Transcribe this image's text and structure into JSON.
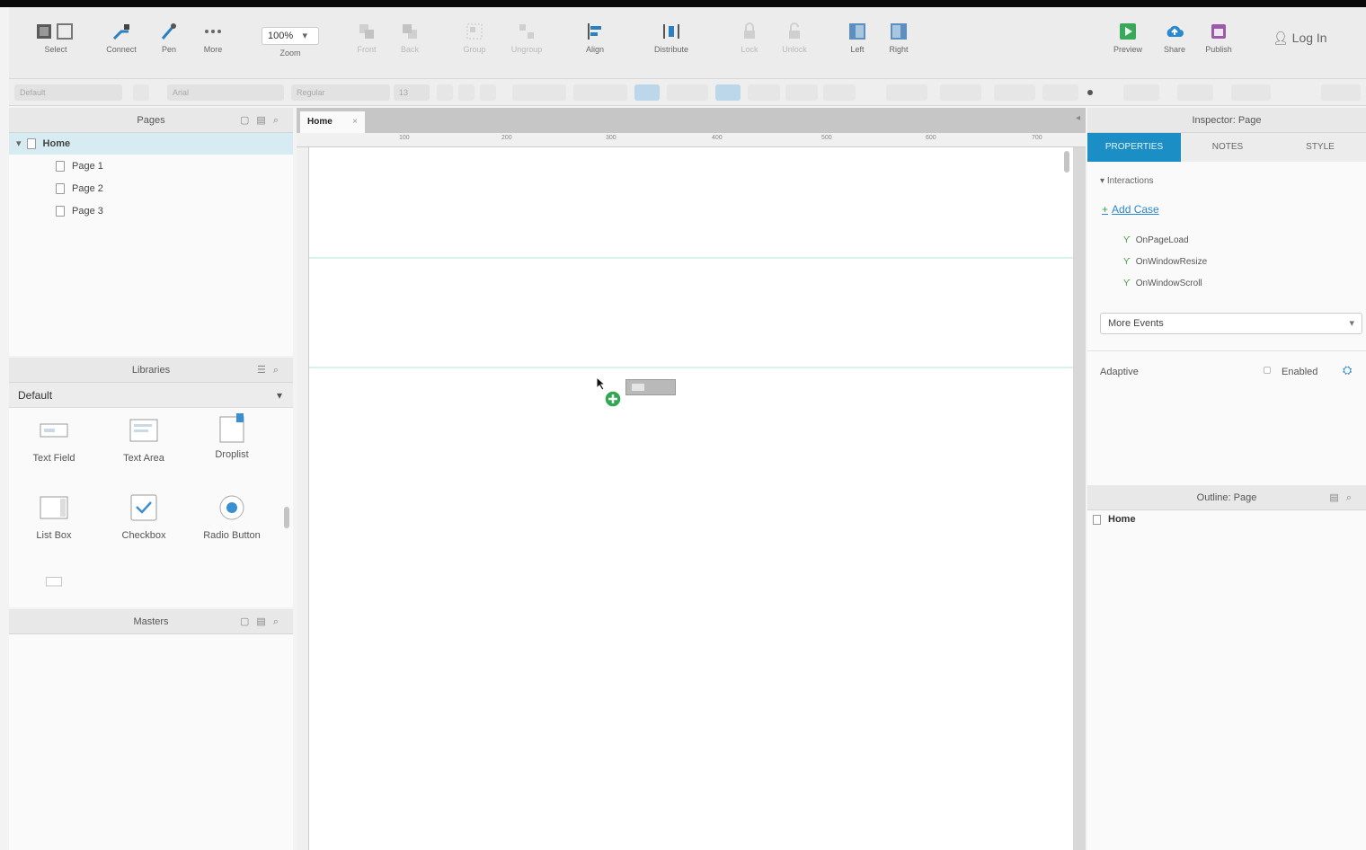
{
  "toolbar": {
    "select_label": "Select",
    "connect_label": "Connect",
    "pen_label": "Pen",
    "more_label": "More",
    "zoom_value": "100%",
    "zoom_label": "Zoom",
    "front_label": "Front",
    "back_label": "Back",
    "group_label": "Group",
    "ungroup_label": "Ungroup",
    "align_label": "Align",
    "distribute_label": "Distribute",
    "lock_label": "Lock",
    "unlock_label": "Unlock",
    "left_label": "Left",
    "right_label": "Right",
    "preview_label": "Preview",
    "share_label": "Share",
    "publish_label": "Publish",
    "login_label": "Log In"
  },
  "formatbar": {
    "style_value": "Default",
    "font_value": "Arial",
    "weight_value": "Regular",
    "size_value": "13"
  },
  "pages_panel": {
    "title": "Pages",
    "items": [
      {
        "label": "Home"
      },
      {
        "label": "Page 1"
      },
      {
        "label": "Page 2"
      },
      {
        "label": "Page 3"
      }
    ]
  },
  "libraries_panel": {
    "title": "Libraries",
    "selected_library": "Default",
    "widgets": [
      {
        "label": "Text Field"
      },
      {
        "label": "Text Area"
      },
      {
        "label": "Droplist"
      },
      {
        "label": "List Box"
      },
      {
        "label": "Checkbox"
      },
      {
        "label": "Radio Button"
      }
    ]
  },
  "masters_panel": {
    "title": "Masters"
  },
  "canvas": {
    "tab_label": "Home",
    "ruler_ticks": [
      "100",
      "200",
      "300",
      "400",
      "500",
      "600",
      "700"
    ]
  },
  "inspector": {
    "title": "Inspector: Page",
    "tabs": [
      {
        "label": "PROPERTIES"
      },
      {
        "label": "NOTES"
      },
      {
        "label": "STYLE"
      }
    ],
    "interactions_label": "Interactions",
    "add_case_label": "Add Case",
    "events": [
      {
        "label": "OnPageLoad"
      },
      {
        "label": "OnWindowResize"
      },
      {
        "label": "OnWindowScroll"
      }
    ],
    "more_events_label": "More Events",
    "adaptive_label": "Adaptive",
    "enabled_label": "Enabled"
  },
  "outline": {
    "title": "Outline: Page",
    "items": [
      {
        "label": "Home"
      }
    ]
  },
  "colors": {
    "accent": "#1b8fc5",
    "selection": "#d7ebf2",
    "add_green": "#2fa84f"
  }
}
